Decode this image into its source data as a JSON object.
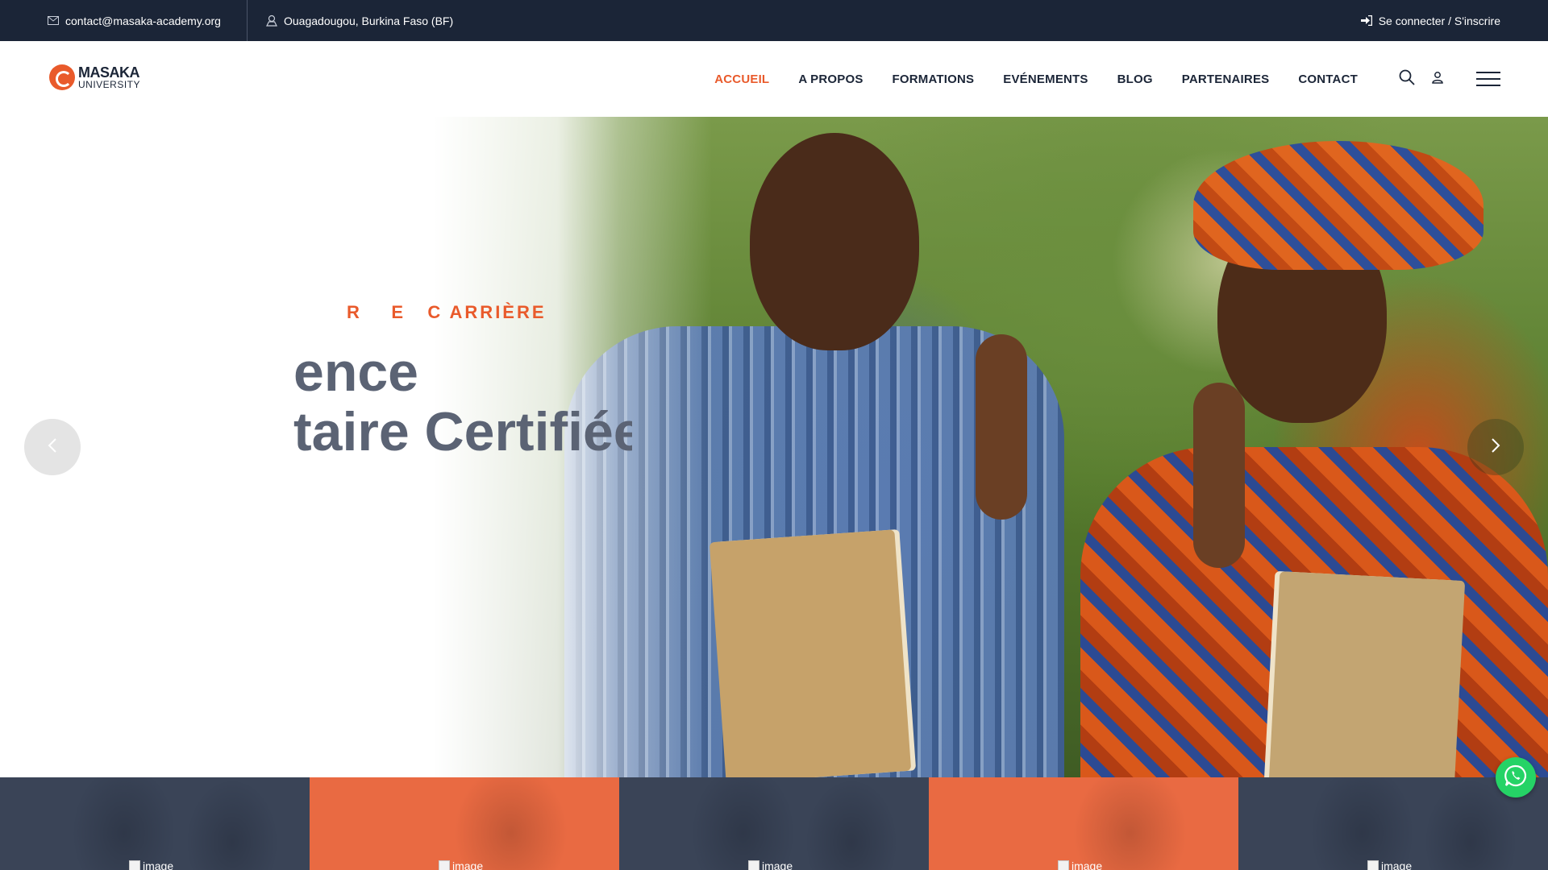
{
  "topbar": {
    "email": "contact@masaka-academy.org",
    "location": "Ouagadougou, Burkina Faso (BF)",
    "login": "Se connecter / S'inscrire"
  },
  "logo": {
    "line1": "MASAKA",
    "line2": "UNIVERSITY"
  },
  "nav": {
    "items": [
      {
        "label": "ACCUEIL",
        "active": true
      },
      {
        "label": "A PROPOS"
      },
      {
        "label": "FORMATIONS"
      },
      {
        "label": "EVÉNEMENTS"
      },
      {
        "label": "BLOG"
      },
      {
        "label": "PARTENAIRES"
      },
      {
        "label": "CONTACT"
      }
    ]
  },
  "hero": {
    "subtitle": "R    E   C ARRIÈRE",
    "title_line1": "ence",
    "title_line2": "taire Certifiée"
  },
  "tiles": [
    {
      "alt": "image"
    },
    {
      "alt": "image"
    },
    {
      "alt": "image"
    },
    {
      "alt": "image"
    },
    {
      "alt": "image"
    }
  ],
  "colors": {
    "accent": "#e95a2b",
    "dark": "#1b2537",
    "tile_dark": "#3a4457",
    "tile_orange": "#e96a42"
  },
  "icons": [
    "envelope-icon",
    "map-pin-icon",
    "sign-in-icon",
    "search-icon",
    "user-icon",
    "menu-icon",
    "chevron-left-icon",
    "chevron-right-icon",
    "whatsapp-icon"
  ]
}
